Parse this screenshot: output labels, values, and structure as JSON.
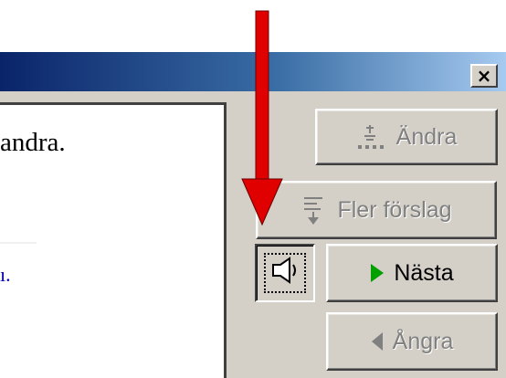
{
  "title_bar": {
    "close_label": "×",
    "close_icon": "close-icon"
  },
  "text_pane": {
    "line1": "andra.",
    "line2": "ı."
  },
  "buttons": {
    "andra": {
      "label": "Ändra",
      "state": "disabled",
      "icon": "change-icon"
    },
    "fler_forslag": {
      "label": "Fler förslag",
      "state": "disabled",
      "icon": "more-suggestions-icon"
    },
    "nasta": {
      "label": "Nästa",
      "state": "enabled",
      "icon": "play-triangle-icon"
    },
    "angra": {
      "label": "Ångra",
      "state": "disabled",
      "icon": "back-triangle-icon"
    },
    "speak": {
      "icon": "speaker-icon",
      "state": "pressed"
    }
  },
  "annotation": {
    "arrow_color": "#e00000",
    "icon": "down-arrow-icon"
  },
  "colors": {
    "title_bar_start": "#0a246a",
    "title_bar_end": "#a6caf0",
    "dialog": "#d4d0c8"
  }
}
